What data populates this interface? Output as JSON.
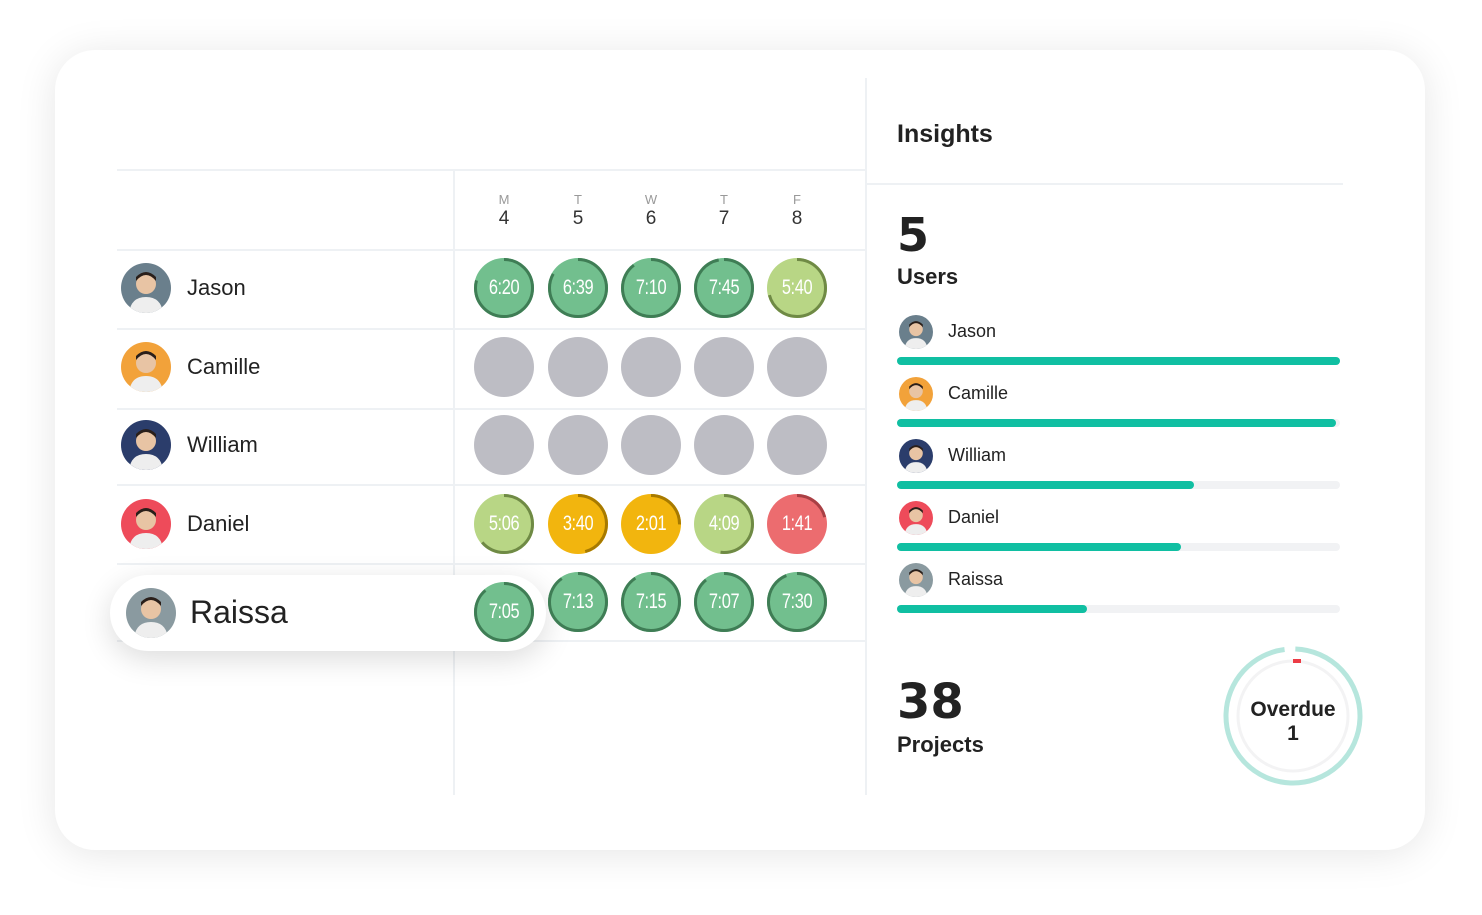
{
  "days": [
    {
      "letter": "M",
      "num": "4"
    },
    {
      "letter": "T",
      "num": "5"
    },
    {
      "letter": "W",
      "num": "6"
    },
    {
      "letter": "T",
      "num": "7"
    },
    {
      "letter": "F",
      "num": "8"
    }
  ],
  "status_colors": {
    "good": "#72bf8e",
    "ok": "#b8d685",
    "warn": "#f2b50e",
    "bad": "#ec6c6f",
    "empty": "#bdbdc4"
  },
  "rows": [
    {
      "name": "Jason",
      "avatar_color": "#6a7f8c",
      "cells": [
        {
          "time": "6:20",
          "status": "good"
        },
        {
          "time": "6:39",
          "status": "good"
        },
        {
          "time": "7:10",
          "status": "good"
        },
        {
          "time": "7:45",
          "status": "good"
        },
        {
          "time": "5:40",
          "status": "ok"
        }
      ]
    },
    {
      "name": "Camille",
      "avatar_color": "#f2a23a",
      "cells": [
        {
          "time": "",
          "status": "empty"
        },
        {
          "time": "",
          "status": "empty"
        },
        {
          "time": "",
          "status": "empty"
        },
        {
          "time": "",
          "status": "empty"
        },
        {
          "time": "",
          "status": "empty"
        }
      ]
    },
    {
      "name": "William",
      "avatar_color": "#2b3d6b",
      "cells": [
        {
          "time": "",
          "status": "empty"
        },
        {
          "time": "",
          "status": "empty"
        },
        {
          "time": "",
          "status": "empty"
        },
        {
          "time": "",
          "status": "empty"
        },
        {
          "time": "",
          "status": "empty"
        }
      ]
    },
    {
      "name": "Daniel",
      "avatar_color": "#ee4b5a",
      "cells": [
        {
          "time": "5:06",
          "status": "ok"
        },
        {
          "time": "3:40",
          "status": "warn"
        },
        {
          "time": "2:01",
          "status": "warn"
        },
        {
          "time": "4:09",
          "status": "ok"
        },
        {
          "time": "1:41",
          "status": "bad"
        }
      ]
    },
    {
      "name": "Raissa",
      "avatar_color": "#8a9aa0",
      "cells": [
        {
          "time": "7:05",
          "status": "good"
        },
        {
          "time": "7:13",
          "status": "good"
        },
        {
          "time": "7:15",
          "status": "good"
        },
        {
          "time": "7:07",
          "status": "good"
        },
        {
          "time": "7:30",
          "status": "good"
        }
      ]
    }
  ],
  "insights": {
    "title": "Insights",
    "users_count": "5",
    "users_label": "Users",
    "user_bars": [
      {
        "name": "Jason",
        "progress": 1.0
      },
      {
        "name": "Camille",
        "progress": 0.99
      },
      {
        "name": "William",
        "progress": 0.67
      },
      {
        "name": "Daniel",
        "progress": 0.64
      },
      {
        "name": "Raissa",
        "progress": 0.43
      }
    ],
    "projects_count": "38",
    "projects_label": "Projects",
    "overdue_label": "Overdue",
    "overdue_count": "1",
    "accent": "#10bfa2"
  }
}
